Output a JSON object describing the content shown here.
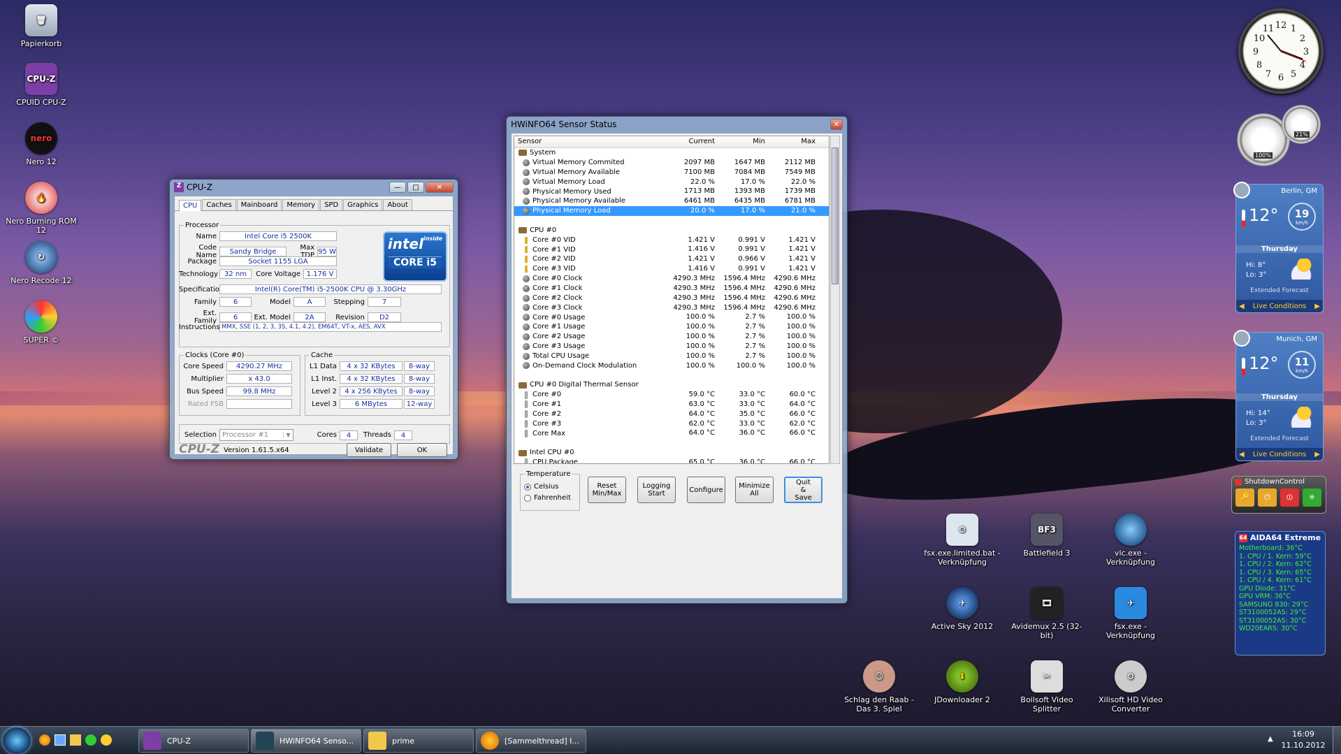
{
  "desktop_icons": [
    {
      "label": "Papierkorb",
      "icon": "recycle-bin-icon"
    },
    {
      "label": "CPUID CPU-Z",
      "icon": "cpuz-icon"
    },
    {
      "label": "Nero 12",
      "icon": "nero-icon"
    },
    {
      "label": "Nero Burning ROM 12",
      "icon": "nero-burning-icon"
    },
    {
      "label": "Nero Recode 12",
      "icon": "nero-recode-icon"
    },
    {
      "label": "SUPER ©",
      "icon": "super-icon"
    },
    {
      "label": "fsx.exe.limited.bat - Verknüpfung",
      "icon": "fsx-bat-icon"
    },
    {
      "label": "Battlefield 3",
      "icon": "battlefield-icon"
    },
    {
      "label": "vlc.exe - Verknüpfung",
      "icon": "vlc-globe-icon"
    },
    {
      "label": "Active Sky 2012",
      "icon": "active-sky-icon"
    },
    {
      "label": "Avidemux 2.5 (32-bit)",
      "icon": "avidemux-icon"
    },
    {
      "label": "fsx.exe - Verknüpfung",
      "icon": "fsx-plane-icon"
    },
    {
      "label": "Schlag den Raab - Das 3. Spiel",
      "icon": "raab-icon"
    },
    {
      "label": "JDownloader 2",
      "icon": "jdownloader-icon"
    },
    {
      "label": "Boilsoft Video Splitter",
      "icon": "boilsoft-icon"
    },
    {
      "label": "Xilisoft HD Video Converter",
      "icon": "xilisoft-icon"
    }
  ],
  "cpuz": {
    "title": "CPU-Z",
    "tabs": [
      "CPU",
      "Caches",
      "Mainboard",
      "Memory",
      "SPD",
      "Graphics",
      "About"
    ],
    "processor": {
      "legend": "Processor",
      "name_label": "Name",
      "name": "Intel Core i5 2500K",
      "codename_label": "Code Name",
      "codename": "Sandy Bridge",
      "maxtdp_label": "Max TDP",
      "maxtdp": "95 W",
      "package_label": "Package",
      "package": "Socket 1155 LGA",
      "technology_label": "Technology",
      "technology": "32 nm",
      "corevoltage_label": "Core Voltage",
      "corevoltage": "1.176 V",
      "spec_label": "Specification",
      "spec": "Intel(R) Core(TM) i5-2500K CPU @ 3.30GHz",
      "family_label": "Family",
      "family": "6",
      "model_label": "Model",
      "model": "A",
      "stepping_label": "Stepping",
      "stepping": "7",
      "extfamily_label": "Ext. Family",
      "extfamily": "6",
      "extmodel_label": "Ext. Model",
      "extmodel": "2A",
      "revision_label": "Revision",
      "revision": "D2",
      "instructions_label": "Instructions",
      "instructions": "MMX, SSE (1, 2, 3, 3S, 4.1, 4.2), EM64T, VT-x, AES, AVX"
    },
    "logo": {
      "brand": "intel",
      "inside": "inside",
      "line": "CORE i5"
    },
    "clocks": {
      "legend": "Clocks (Core #0)",
      "corespeed_label": "Core Speed",
      "corespeed": "4290.27 MHz",
      "multiplier_label": "Multiplier",
      "multiplier": "x 43.0",
      "busspeed_label": "Bus Speed",
      "busspeed": "99.8 MHz",
      "ratedfsb_label": "Rated FSB",
      "ratedfsb": ""
    },
    "cache": {
      "legend": "Cache",
      "l1d_label": "L1 Data",
      "l1d": "4 x 32 KBytes",
      "l1d_way": "8-way",
      "l1i_label": "L1 Inst.",
      "l1i": "4 x 32 KBytes",
      "l1i_way": "8-way",
      "l2_label": "Level 2",
      "l2": "4 x 256 KBytes",
      "l2_way": "8-way",
      "l3_label": "Level 3",
      "l3": "6 MBytes",
      "l3_way": "12-way"
    },
    "selection_label": "Selection",
    "selection": "Processor #1",
    "cores_label": "Cores",
    "cores": "4",
    "threads_label": "Threads",
    "threads": "4",
    "brand": "CPU-Z",
    "version": "Version 1.61.5.x64",
    "validate": "Validate",
    "ok": "OK"
  },
  "hwinfo": {
    "title": "HWiNFO64 Sensor Status",
    "columns": [
      "Sensor",
      "Current",
      "Min",
      "Max"
    ],
    "rows": [
      {
        "type": "group",
        "name": "System"
      },
      {
        "type": "sensor",
        "icon": "sensor-icon",
        "name": "Virtual Memory Commited",
        "current": "2097 MB",
        "min": "1647 MB",
        "max": "2112 MB"
      },
      {
        "type": "sensor",
        "icon": "sensor-icon",
        "name": "Virtual Memory Available",
        "current": "7100 MB",
        "min": "7084 MB",
        "max": "7549 MB"
      },
      {
        "type": "sensor",
        "icon": "sensor-icon",
        "name": "Virtual Memory Load",
        "current": "22.0 %",
        "min": "17.0 %",
        "max": "22.0 %"
      },
      {
        "type": "sensor",
        "icon": "sensor-icon",
        "name": "Physical Memory Used",
        "current": "1713 MB",
        "min": "1393 MB",
        "max": "1739 MB"
      },
      {
        "type": "sensor",
        "icon": "sensor-icon",
        "name": "Physical Memory Available",
        "current": "6461 MB",
        "min": "6435 MB",
        "max": "6781 MB"
      },
      {
        "type": "sensor",
        "icon": "sensor-icon",
        "name": "Physical Memory Load",
        "current": "20.0 %",
        "min": "17.0 %",
        "max": "21.0 %",
        "selected": true
      },
      {
        "type": "blank"
      },
      {
        "type": "group",
        "name": "CPU #0"
      },
      {
        "type": "sensor",
        "icon": "voltage-icon",
        "name": "Core #0 VID",
        "current": "1.421 V",
        "min": "0.991 V",
        "max": "1.421 V"
      },
      {
        "type": "sensor",
        "icon": "voltage-icon",
        "name": "Core #1 VID",
        "current": "1.416 V",
        "min": "0.991 V",
        "max": "1.421 V"
      },
      {
        "type": "sensor",
        "icon": "voltage-icon",
        "name": "Core #2 VID",
        "current": "1.421 V",
        "min": "0.966 V",
        "max": "1.421 V"
      },
      {
        "type": "sensor",
        "icon": "voltage-icon",
        "name": "Core #3 VID",
        "current": "1.416 V",
        "min": "0.991 V",
        "max": "1.421 V"
      },
      {
        "type": "sensor",
        "icon": "sensor-icon",
        "name": "Core #0 Clock",
        "current": "4290.3 MHz",
        "min": "1596.4 MHz",
        "max": "4290.6 MHz"
      },
      {
        "type": "sensor",
        "icon": "sensor-icon",
        "name": "Core #1 Clock",
        "current": "4290.3 MHz",
        "min": "1596.4 MHz",
        "max": "4290.6 MHz"
      },
      {
        "type": "sensor",
        "icon": "sensor-icon",
        "name": "Core #2 Clock",
        "current": "4290.3 MHz",
        "min": "1596.4 MHz",
        "max": "4290.6 MHz"
      },
      {
        "type": "sensor",
        "icon": "sensor-icon",
        "name": "Core #3 Clock",
        "current": "4290.3 MHz",
        "min": "1596.4 MHz",
        "max": "4290.6 MHz"
      },
      {
        "type": "sensor",
        "icon": "sensor-icon",
        "name": "Core #0 Usage",
        "current": "100.0 %",
        "min": "2.7 %",
        "max": "100.0 %"
      },
      {
        "type": "sensor",
        "icon": "sensor-icon",
        "name": "Core #1 Usage",
        "current": "100.0 %",
        "min": "2.7 %",
        "max": "100.0 %"
      },
      {
        "type": "sensor",
        "icon": "sensor-icon",
        "name": "Core #2 Usage",
        "current": "100.0 %",
        "min": "2.7 %",
        "max": "100.0 %"
      },
      {
        "type": "sensor",
        "icon": "sensor-icon",
        "name": "Core #3 Usage",
        "current": "100.0 %",
        "min": "2.7 %",
        "max": "100.0 %"
      },
      {
        "type": "sensor",
        "icon": "sensor-icon",
        "name": "Total CPU Usage",
        "current": "100.0 %",
        "min": "2.7 %",
        "max": "100.0 %"
      },
      {
        "type": "sensor",
        "icon": "sensor-icon",
        "name": "On-Demand Clock Modulation",
        "current": "100.0 %",
        "min": "100.0 %",
        "max": "100.0 %"
      },
      {
        "type": "blank"
      },
      {
        "type": "group",
        "name": "CPU #0 Digital Thermal Sensor"
      },
      {
        "type": "sensor",
        "icon": "thermometer-icon",
        "name": "Core #0",
        "current": "59.0 °C",
        "min": "33.0 °C",
        "max": "60.0 °C"
      },
      {
        "type": "sensor",
        "icon": "thermometer-icon",
        "name": "Core #1",
        "current": "63.0 °C",
        "min": "33.0 °C",
        "max": "64.0 °C"
      },
      {
        "type": "sensor",
        "icon": "thermometer-icon",
        "name": "Core #2",
        "current": "64.0 °C",
        "min": "35.0 °C",
        "max": "66.0 °C"
      },
      {
        "type": "sensor",
        "icon": "thermometer-icon",
        "name": "Core #3",
        "current": "62.0 °C",
        "min": "33.0 °C",
        "max": "62.0 °C"
      },
      {
        "type": "sensor",
        "icon": "thermometer-icon",
        "name": "Core Max",
        "current": "64.0 °C",
        "min": "36.0 °C",
        "max": "66.0 °C"
      },
      {
        "type": "blank"
      },
      {
        "type": "group",
        "name": "Intel CPU #0"
      },
      {
        "type": "sensor",
        "icon": "thermometer-icon",
        "name": "CPU Package",
        "current": "65.0 °C",
        "min": "36.0 °C",
        "max": "66.0 °C"
      }
    ],
    "temperature_legend": "Temperature",
    "celsius": "Celsius",
    "fahrenheit": "Fahrenheit",
    "unit_selected": "Celsius",
    "buttons": {
      "reset": "Reset Min/Max",
      "logging": "Logging Start",
      "configure": "Configure",
      "minimize": "Minimize All",
      "quit": "Quit & Save"
    }
  },
  "gadgets": {
    "weather": [
      {
        "city": "Berlin, GM",
        "temp": "12°",
        "wind": "19",
        "wind_unit": "km/h",
        "day": "Thursday",
        "hi": "Hi: 8°",
        "lo": "Lo: 3°",
        "extended": "Extended Forecast",
        "live": "Live Conditions"
      },
      {
        "city": "Munich, GM",
        "temp": "12°",
        "wind": "11",
        "wind_unit": "km/h",
        "day": "Thursday",
        "hi": "Hi: 14°",
        "lo": "Lo: 3°",
        "extended": "Extended Forecast",
        "live": "Live Conditions"
      }
    ],
    "meter": {
      "cpu": "100%",
      "mem": "21%"
    },
    "shutdown": {
      "title": "ShutdownControl"
    },
    "aida": {
      "title": "AIDA64 Extreme",
      "lines": [
        "Motherboard: 36°C",
        "1. CPU / 1. Kern: 59°C",
        "1. CPU / 2. Kern: 62°C",
        "1. CPU / 3. Kern: 65°C",
        "1. CPU / 4. Kern: 61°C",
        "GPU Diode: 31°C",
        "GPU VRM: 36°C",
        "SAMSUNG 830: 29°C",
        "ST3100052AS: 29°C",
        "ST3100052AS: 30°C",
        "WD20EARS: 30°C"
      ]
    }
  },
  "taskbar": {
    "items": [
      {
        "label": "CPU-Z",
        "icon": "cpuz-icon"
      },
      {
        "label": "HWiNFO64 Senso...",
        "icon": "hwinfo-icon"
      },
      {
        "label": "prime",
        "icon": "folder-icon"
      },
      {
        "label": "[Sammelthread] I...",
        "icon": "firefox-icon"
      }
    ],
    "time": "16:09",
    "date": "11.10.2012"
  }
}
